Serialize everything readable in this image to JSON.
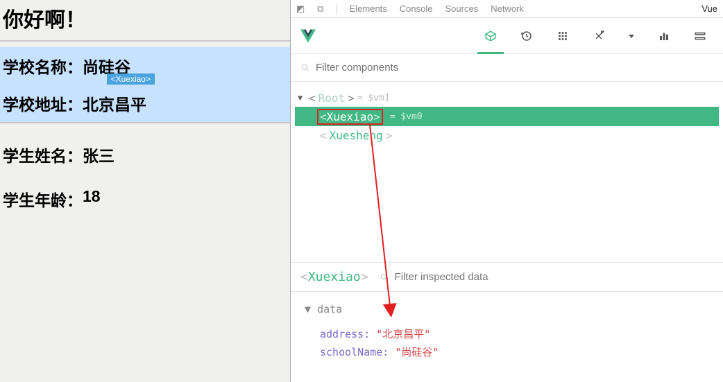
{
  "app": {
    "greeting": "你好啊！",
    "school": {
      "name_label": "学校名称：",
      "name_value": "尚硅谷",
      "addr_label": "学校地址：",
      "addr_value": "北京昌平",
      "tag": "<Xuexiao>"
    },
    "student": {
      "name_label": "学生姓名：",
      "name_value": "张三",
      "age_label": "学生年龄：",
      "age_value": "18"
    }
  },
  "devtoolsTabs": [
    "Elements",
    "Console",
    "Sources",
    "Network",
    "Vue"
  ],
  "devtoolsActiveTab": "Vue",
  "componentFilterPlaceholder": "Filter components",
  "tree": {
    "root": {
      "name": "Root",
      "vm": "= $vm1"
    },
    "selected": {
      "name": "Xuexiao",
      "vm": "= $vm0"
    },
    "child": {
      "name": "Xuesheng"
    }
  },
  "inspector": {
    "componentName": "Xuexiao",
    "filterPlaceholder": "Filter inspected data",
    "dataLabel": "data",
    "data": {
      "address_key": "address:",
      "address_val": "\"北京昌平\"",
      "school_key": "schoolName:",
      "school_val": "\"尚硅谷\""
    }
  },
  "icons": {
    "components": "components-icon",
    "timeline": "timeline-icon",
    "grid": "grid-icon",
    "arrows": "arrows-icon",
    "dropdown": "dropdown-icon",
    "bar": "bar-icon"
  }
}
